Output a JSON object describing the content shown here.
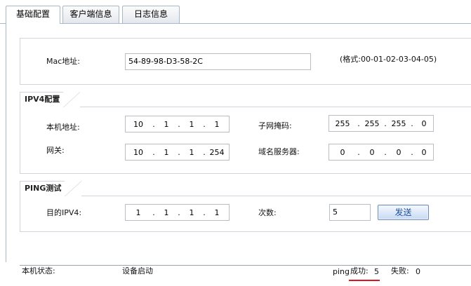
{
  "tabs": [
    {
      "label": "基础配置",
      "active": true
    },
    {
      "label": "客户端信息",
      "active": false
    },
    {
      "label": "日志信息",
      "active": false
    }
  ],
  "mac": {
    "label": "Mac地址:",
    "value": "54-89-98-D3-58-2C",
    "format_hint": "(格式:00-01-02-03-04-05)"
  },
  "ipv4": {
    "title": "IPV4配置",
    "local_ip": {
      "label": "本机地址:",
      "octets": [
        "10",
        "1",
        "1",
        "1"
      ]
    },
    "subnet": {
      "label": "子网掩码:",
      "octets": [
        "255",
        "255",
        "255",
        "0"
      ]
    },
    "gateway": {
      "label": "网关:",
      "octets": [
        "10",
        "1",
        "1",
        "254"
      ]
    },
    "dns": {
      "label": "域名服务器:",
      "octets": [
        "0",
        "0",
        "0",
        "0"
      ]
    }
  },
  "ping": {
    "title": "PING测试",
    "target": {
      "label": "目的IPV4:",
      "octets": [
        "1",
        "1",
        "1",
        "1"
      ]
    },
    "count": {
      "label": "次数:",
      "value": "5"
    },
    "send_label": "发送"
  },
  "status": {
    "label": "本机状态:",
    "value": "设备启动",
    "ping_prefix": "ping",
    "success_label": "成功:",
    "success_value": "5",
    "fail_label": "失败:",
    "fail_value": "0"
  },
  "colors": {
    "underline": "#e0141e",
    "border": "#a9b8c8",
    "button_text": "#1f4fa1"
  }
}
